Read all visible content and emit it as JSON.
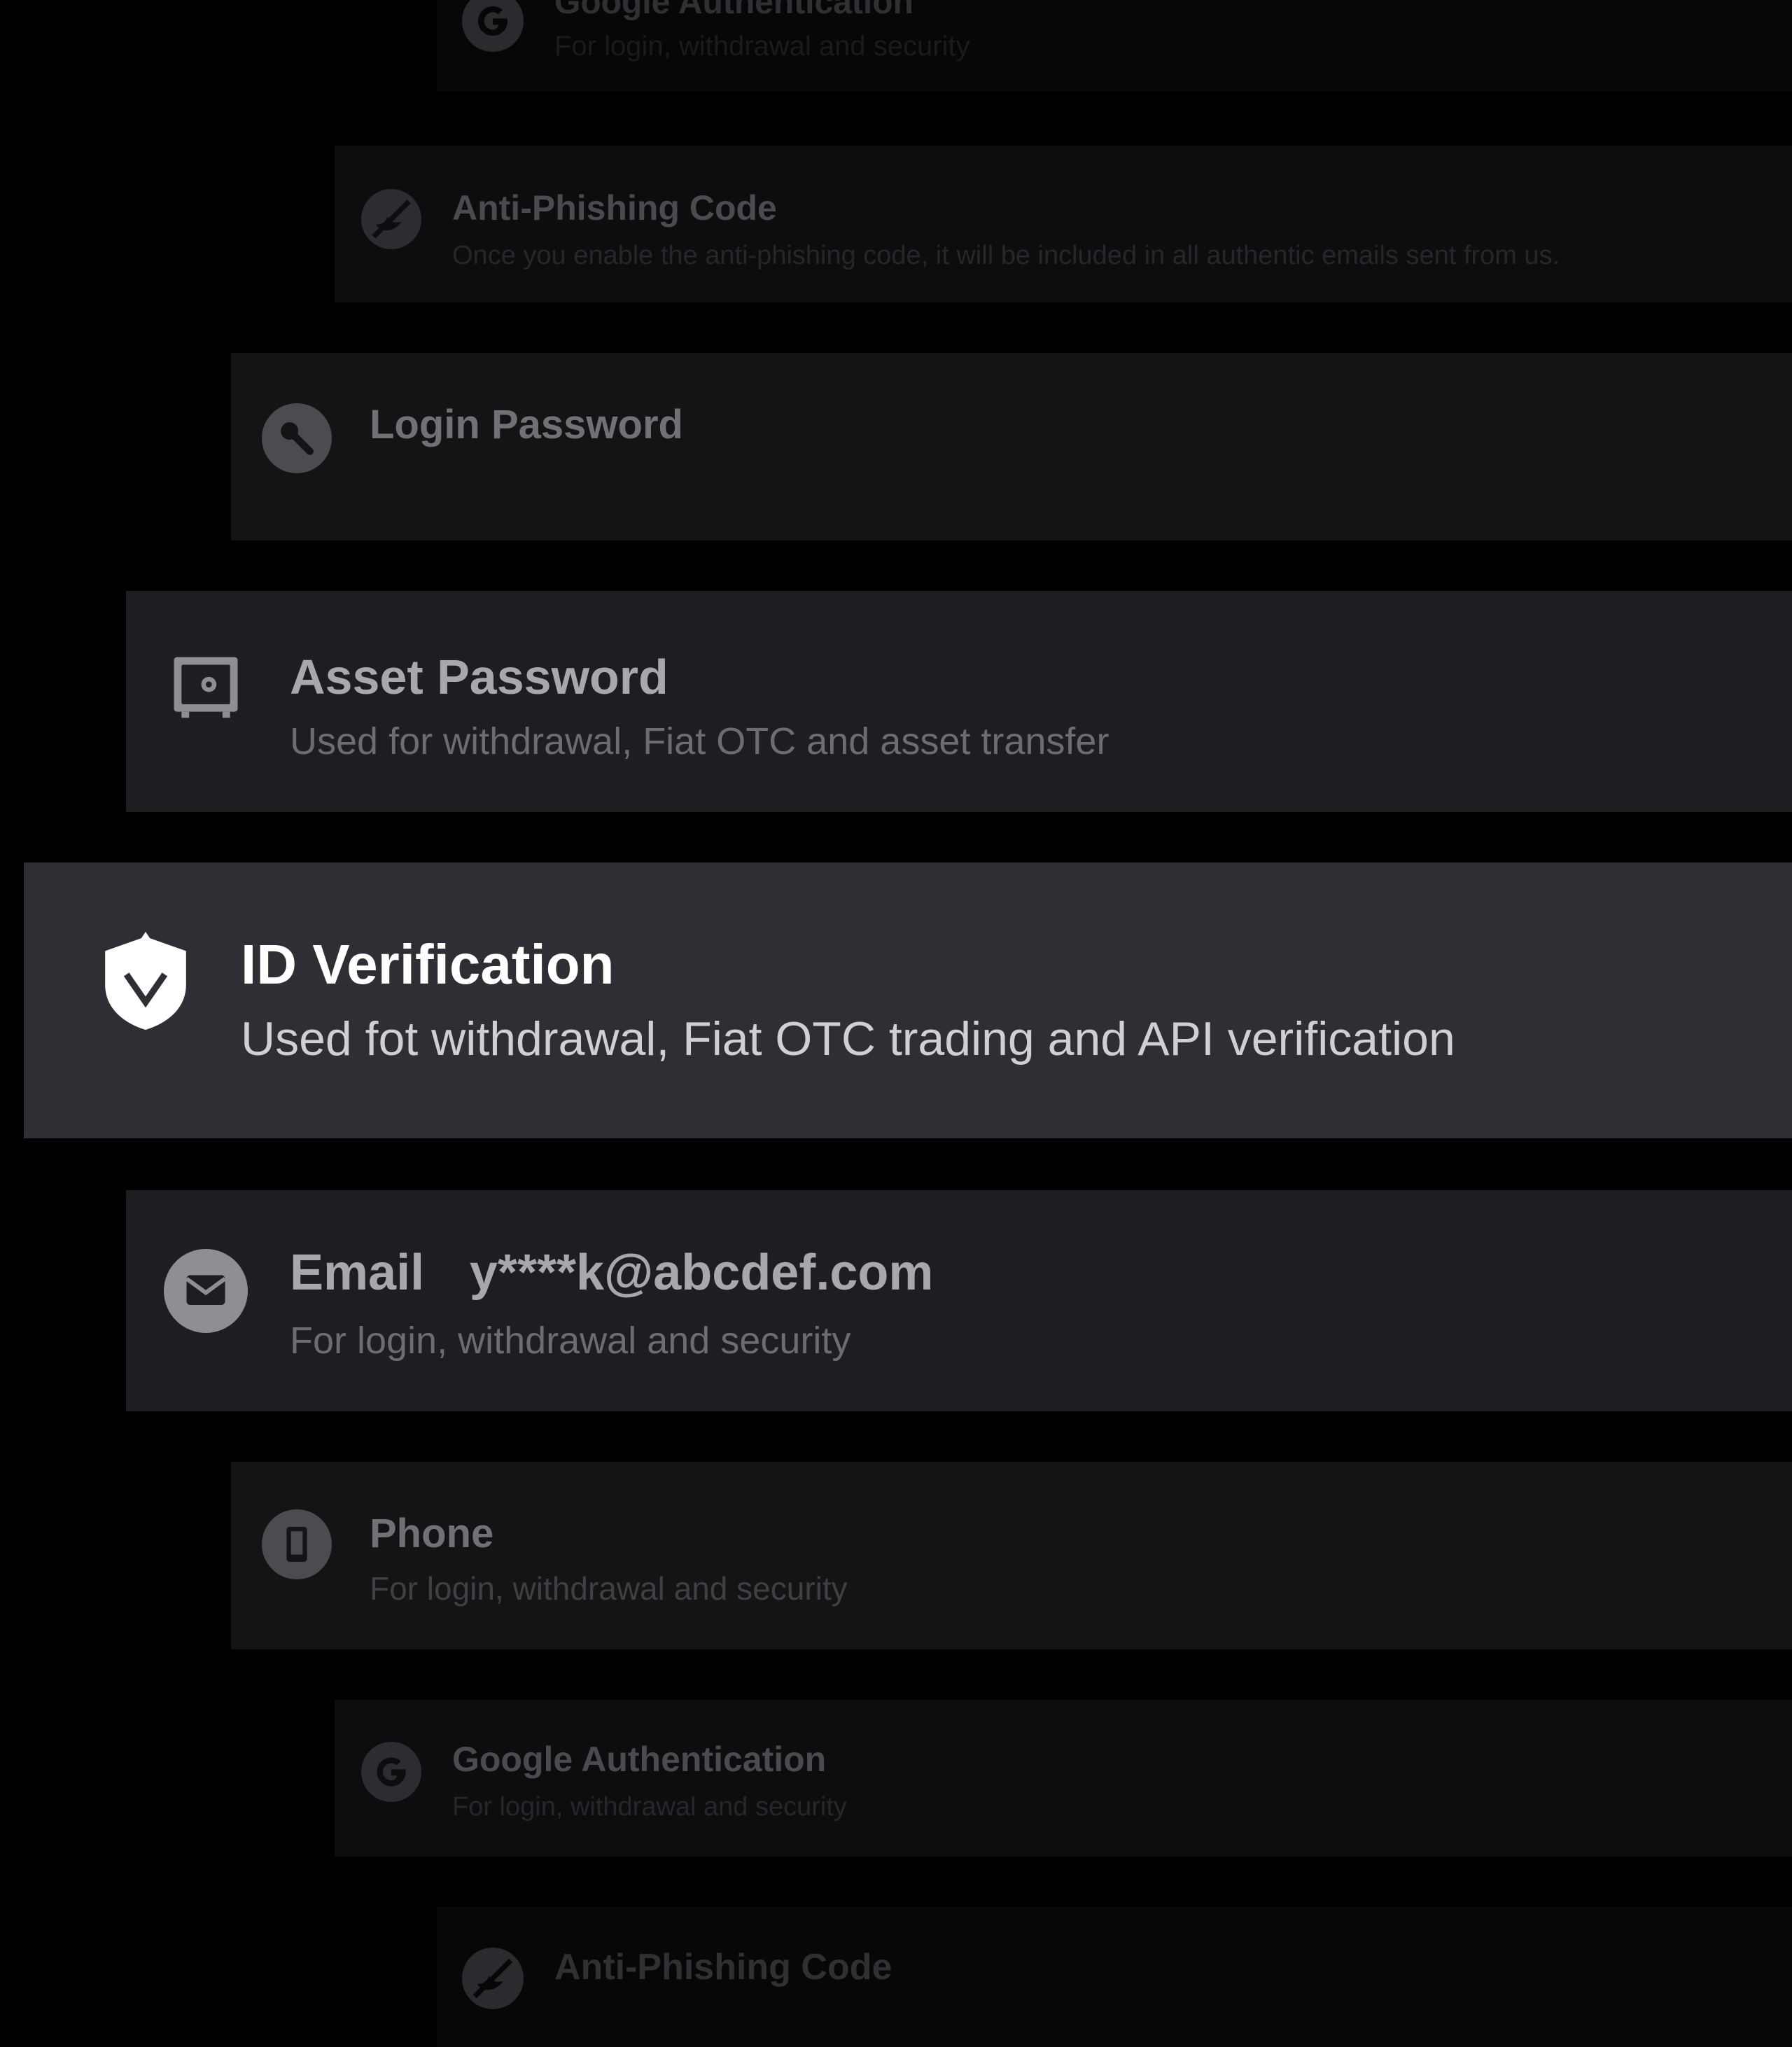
{
  "security_items": [
    {
      "id": "google-auth-top",
      "icon": "google-icon",
      "title": "Google Authentication",
      "subtitle": "For login, withdrawal and security"
    },
    {
      "id": "anti-phishing-top",
      "icon": "anti-phishing-icon",
      "title": "Anti-Phishing Code",
      "subtitle": "Once you enable the anti-phishing code, it will be included in all authentic emails sent from us."
    },
    {
      "id": "login-password",
      "icon": "key-icon",
      "title": "Login Password"
    },
    {
      "id": "asset-password",
      "icon": "safe-icon",
      "title": "Asset Password",
      "subtitle": "Used for withdrawal, Fiat OTC and asset transfer"
    },
    {
      "id": "id-verification",
      "icon": "shield-check-icon",
      "title": "ID Verification",
      "subtitle": "Used fot withdrawal, Fiat OTC trading and API verification",
      "focused": true
    },
    {
      "id": "email",
      "icon": "mail-icon",
      "title": "Email",
      "value": "y****k@abcdef.com",
      "subtitle": "For login, withdrawal and security"
    },
    {
      "id": "phone",
      "icon": "phone-icon",
      "title": "Phone",
      "subtitle": "For login, withdrawal and security"
    },
    {
      "id": "google-auth-bottom",
      "icon": "google-icon",
      "title": "Google Authentication",
      "subtitle": "For login, withdrawal and security"
    },
    {
      "id": "anti-phishing-bottom",
      "icon": "anti-phishing-icon",
      "title": "Anti-Phishing Code"
    }
  ],
  "colors": {
    "background": "#000000",
    "focused_card": "#2e2f35",
    "card_near": "#1d1e21",
    "card_mid": "#141416",
    "card_far": "#0d0d0f",
    "text_primary": "#ffffff"
  }
}
